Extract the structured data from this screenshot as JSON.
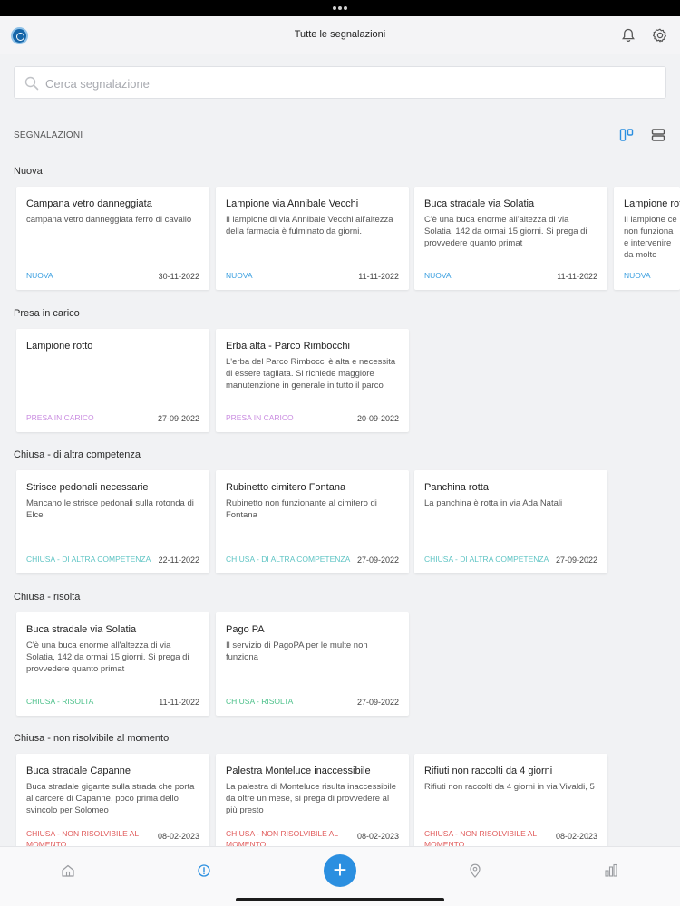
{
  "header": {
    "title": "Tutte le segnalazioni"
  },
  "search": {
    "placeholder": "Cerca segnalazione"
  },
  "section": {
    "label": "SEGNALAZIONI"
  },
  "colors": {
    "nuova": "#3a9fe0",
    "presa": "#c98be0",
    "chiusa_altra": "#5ec4c4",
    "chiusa_risolta": "#4cc08a",
    "non_risolvibile": "#e05a5a",
    "fab": "#2b8fe0"
  },
  "groups": [
    {
      "title": "Nuova",
      "cards": [
        {
          "title": "Campana vetro danneggiata",
          "desc": " campana vetro danneggiata ferro di cavallo",
          "status": "NUOVA",
          "date": "30-11-2022"
        },
        {
          "title": "Lampione via Annibale Vecchi",
          "desc": " Il lampione di via Annibale Vecchi all'altezza della farmacia è fulminato da giorni.",
          "status": "NUOVA",
          "date": "11-11-2022"
        },
        {
          "title": "Buca stradale via Solatia",
          "desc": " C'è una buca enorme all'altezza di via Solatia, 142 da ormai 15 giorni. Si prega di provvedere quanto primat",
          "status": "NUOVA",
          "date": "11-11-2022"
        },
        {
          "title": "Lampione rotto",
          "desc": " Il lampione ce non funziona e intervenire da molto frequen",
          "status": "NUOVA",
          "date": ""
        }
      ]
    },
    {
      "title": "Presa in carico",
      "cards": [
        {
          "title": "Lampione rotto",
          "desc": "",
          "status": "PRESA IN CARICO",
          "date": "27-09-2022"
        },
        {
          "title": "Erba alta - Parco Rimbocchi",
          "desc": "L'erba del Parco Rimbocci è alta e necessita di essere tagliata. Si richiede maggiore manutenzione in generale in tutto il parco",
          "status": "PRESA IN CARICO",
          "date": "20-09-2022"
        }
      ]
    },
    {
      "title": "Chiusa - di altra competenza",
      "cards": [
        {
          "title": "Strisce pedonali necessarie",
          "desc": " Mancano le strisce pedonali sulla rotonda di Elce",
          "status": "CHIUSA - DI ALTRA COMPETENZA",
          "date": "22-11-2022"
        },
        {
          "title": "Rubinetto cimitero Fontana",
          "desc": " Rubinetto non funzionante al cimitero di Fontana",
          "status": "CHIUSA - DI ALTRA COMPETENZA",
          "date": "27-09-2022"
        },
        {
          "title": "Panchina rotta",
          "desc": " La panchina è rotta in via Ada Natali",
          "status": "CHIUSA - DI ALTRA COMPETENZA",
          "date": "27-09-2022"
        }
      ]
    },
    {
      "title": "Chiusa - risolta",
      "cards": [
        {
          "title": "Buca stradale via Solatia",
          "desc": " C'è una buca enorme all'altezza di via Solatia, 142 da ormai 15 giorni. Si prega di provvedere quanto primat",
          "status": "CHIUSA - RISOLTA",
          "date": "11-11-2022"
        },
        {
          "title": "Pago PA",
          "desc": " Il servizio di PagoPA per le multe non funziona",
          "status": "CHIUSA - RISOLTA",
          "date": "27-09-2022"
        }
      ]
    },
    {
      "title": "Chiusa - non risolvibile al momento",
      "cards": [
        {
          "title": "Buca stradale Capanne",
          "desc": " Buca stradale gigante sulla strada che porta al carcere di Capanne, poco prima dello svincolo per Solomeo",
          "status": "CHIUSA - NON RISOLVIBILE AL MOMENTO",
          "date": "08-02-2023"
        },
        {
          "title": "Palestra Monteluce inaccessibile",
          "desc": " La palestra di Monteluce risulta inaccessibile da oltre un mese, si prega di provvedere al più presto",
          "status": "CHIUSA - NON RISOLVIBILE AL MOMENTO",
          "date": "08-02-2023"
        },
        {
          "title": "Rifiuti non raccolti da 4 giorni",
          "desc": " Rifiuti non raccolti da 4 giorni in via Vivaldi, 5",
          "status": "CHIUSA - NON RISOLVIBILE AL MOMENTO",
          "date": "08-02-2023"
        }
      ]
    }
  ],
  "fab": {
    "label": "+"
  }
}
